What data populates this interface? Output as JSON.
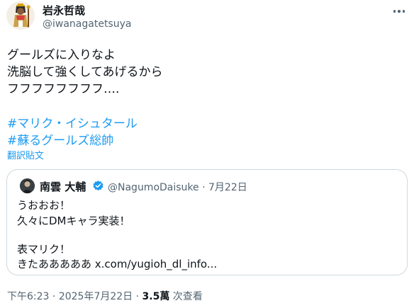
{
  "author": {
    "display_name": "岩永哲哉",
    "handle": "@iwanagatetsuya",
    "avatar_icon": "pharaoh-avatar-icon"
  },
  "tweet": {
    "lines": [
      "グールズに入りなよ",
      "洗脳して強くしてあげるから",
      "フフフフフフフフ…."
    ],
    "hashtags": [
      "#マリク・イシュタール",
      "#蘇るグールズ総帥"
    ],
    "translate_label": "翻訳貼文"
  },
  "quote": {
    "display_name": "南雲 大輔",
    "handle": "@NagumoDaisuke",
    "separator": "·",
    "date": "7月22日",
    "lines": [
      "うおおお！",
      "久々にDMキャラ実装！",
      "",
      "表マリク！",
      "きたあああああ x.com/yugioh_dl_info..."
    ],
    "verified_color": "#1d9bf0"
  },
  "meta": {
    "time": "下午6:23",
    "separator": "·",
    "date": "2025年7月22日",
    "views_count": "3.5萬",
    "views_label": "次查看"
  },
  "colors": {
    "text": "#0f1419",
    "secondary": "#536471",
    "accent": "#1d9bf0",
    "border": "#cfd9de"
  }
}
